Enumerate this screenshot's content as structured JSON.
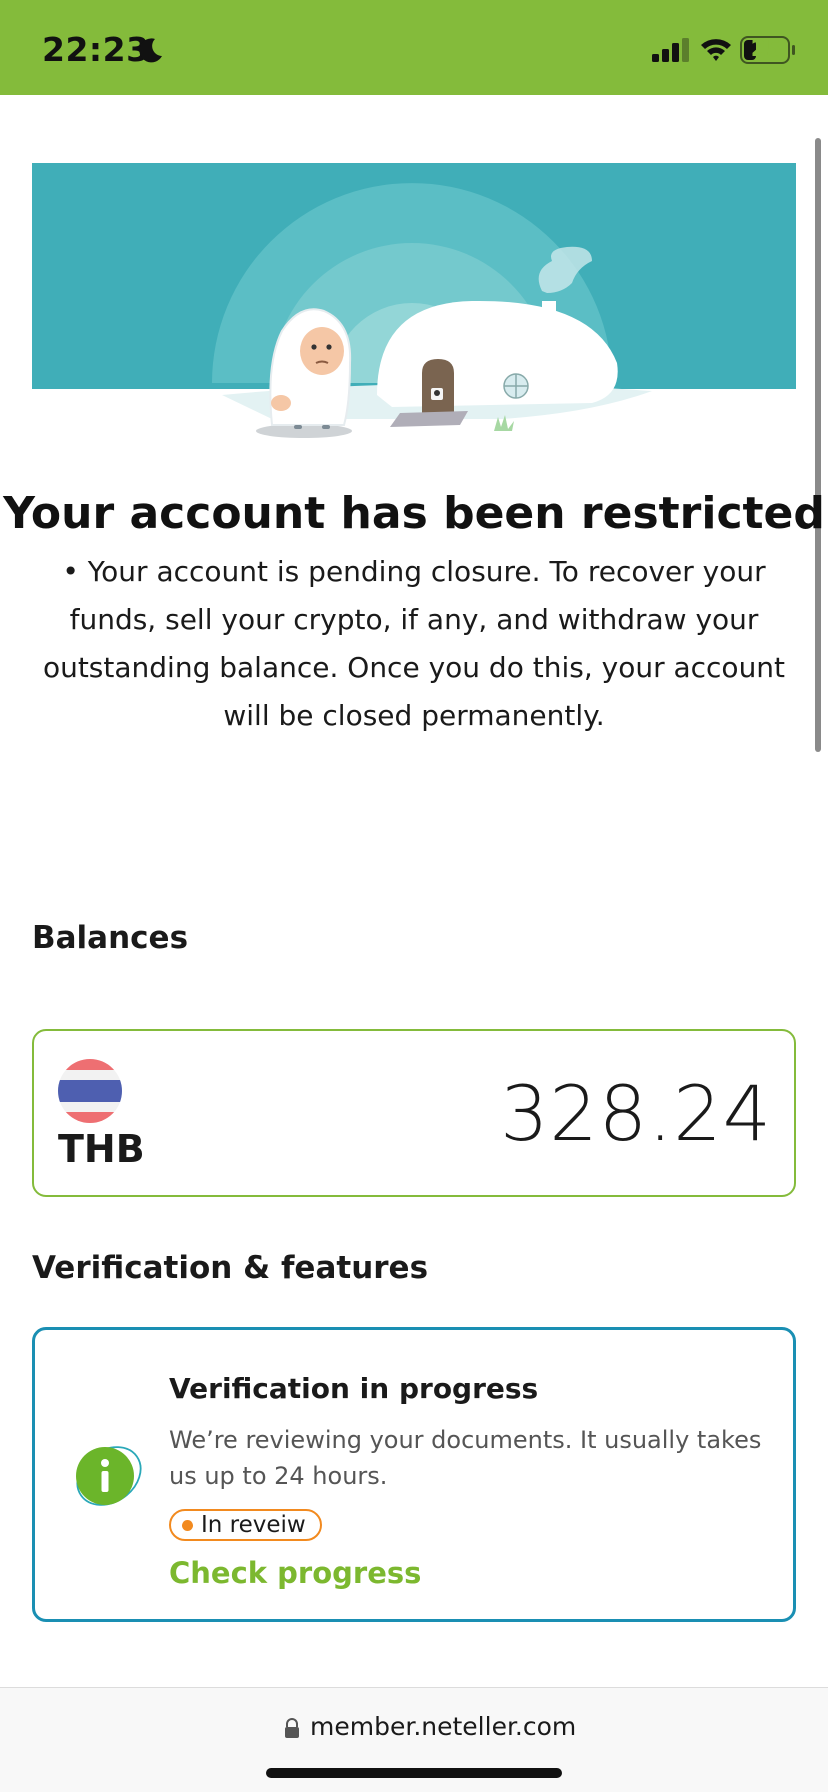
{
  "status_bar": {
    "time": "22:23",
    "battery": "25",
    "icons": [
      "moon-icon",
      "signal-icon",
      "wifi-icon",
      "battery-icon"
    ],
    "color": "#84bb3b"
  },
  "hero": {
    "illustration": "yeti-igloo-illustration",
    "bg_color": "#40aeb8"
  },
  "restriction": {
    "title": "Your account has been restricted",
    "body": "• Your account is pending closure. To recover your funds, sell your crypto, if any, and withdraw your outstanding balance. Once you do this, your account will be closed permanently."
  },
  "balances": {
    "title": "Balances",
    "items": [
      {
        "currency": "THB",
        "amount": "328.24",
        "flag": "thailand-flag-icon"
      }
    ]
  },
  "verification": {
    "title": "Verification & features",
    "card": {
      "heading": "Verification in progress",
      "description": "We’re reviewing your documents. It usually takes us up to 24 hours.",
      "status": "In reveiw",
      "link": "Check progress",
      "icon": "info-icon"
    }
  },
  "browser": {
    "url": "member.neteller.com",
    "icon": "lock-icon"
  },
  "colors": {
    "accent_green": "#84bb3b",
    "link_green": "#7cb82f",
    "card_blue": "#1a8fb3",
    "badge_orange": "#f28a1f"
  }
}
